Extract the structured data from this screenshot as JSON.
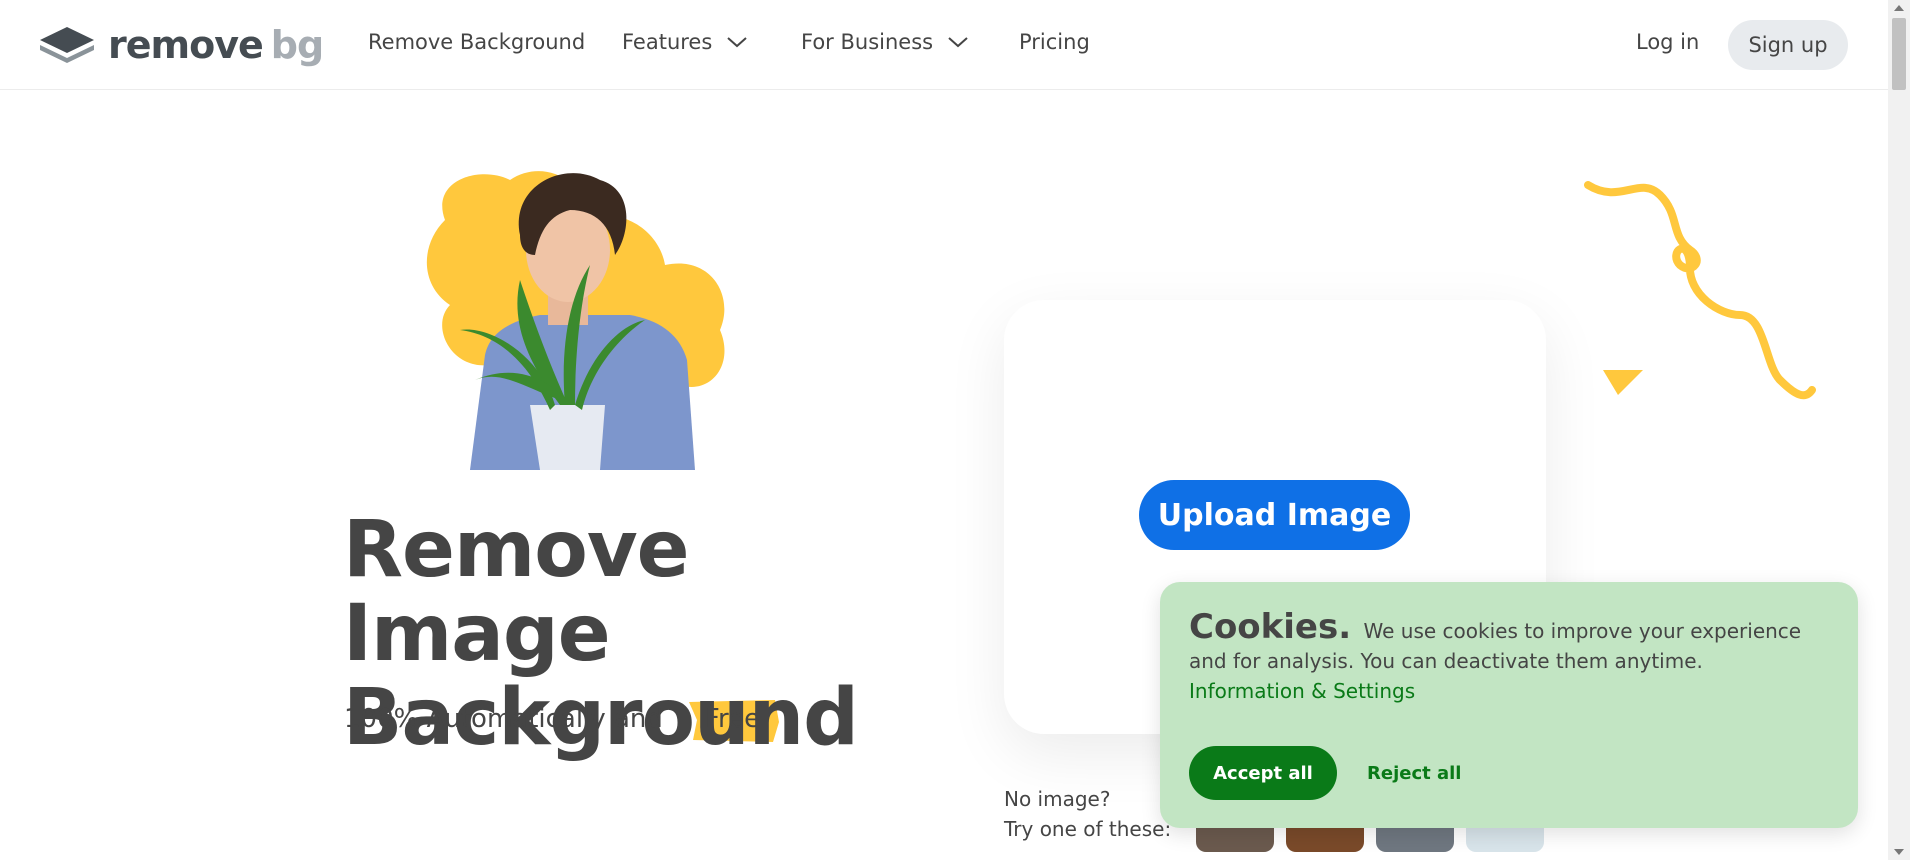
{
  "nav": {
    "logo_main": "remove",
    "logo_accent": "bg",
    "links": [
      {
        "label": "Remove Background"
      },
      {
        "label": "Features"
      },
      {
        "label": "For Business"
      },
      {
        "label": "Pricing"
      }
    ],
    "login_label": "Log in",
    "signup_label": "Sign up"
  },
  "hero": {
    "title_line1": "Remove Image",
    "title_line2": "Background",
    "subtitle": "100% Automatically and",
    "free_label": "Free"
  },
  "upload": {
    "button_label": "Upload Image",
    "no_image_line1": "No image?",
    "no_image_line2": "Try one of these:"
  },
  "cookies": {
    "title": "Cookies.",
    "body": "We use cookies to improve your experience and for analysis. You can deactivate them anytime.",
    "link": "Information & Settings",
    "accept_label": "Accept all",
    "reject_label": "Reject all"
  },
  "colors": {
    "primary_blue": "#0f70e6",
    "accent_yellow": "#ffc83d",
    "cookie_bg": "#c2e5c3",
    "cookie_green": "#0a7a18"
  }
}
